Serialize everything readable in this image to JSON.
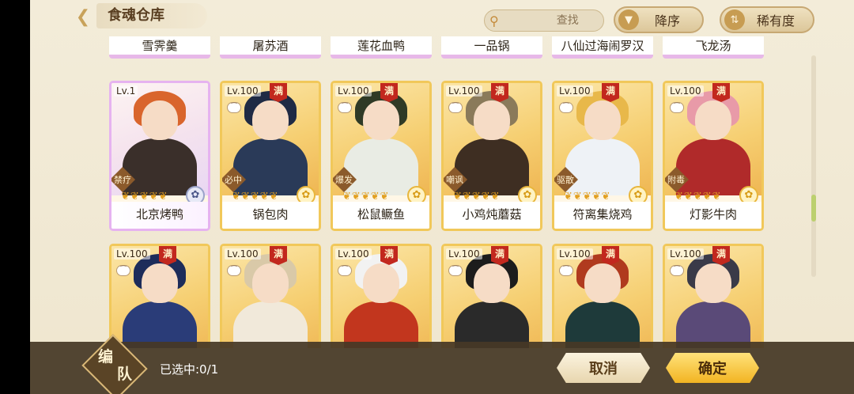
{
  "header": {
    "back_icon": "back-arrow-icon",
    "title": "食魂仓库",
    "search": {
      "placeholder": "查找",
      "value": ""
    },
    "sort_label": "降序",
    "rarity_label": "稀有度"
  },
  "top_row_names": [
    "雪霁羹",
    "屠苏酒",
    "莲花血鸭",
    "一品锅",
    "八仙过海闹罗汉",
    "飞龙汤"
  ],
  "cards_row1": [
    {
      "level": "Lv.1",
      "name": "北京烤鸭",
      "role": "禁疗",
      "maxed": "",
      "frame": "rainbow",
      "hair": "#d9652c",
      "body": "#3a2f2a"
    },
    {
      "level": "Lv.100",
      "name": "锅包肉",
      "role": "必中",
      "maxed": "满",
      "frame": "gold",
      "hair": "#1f2a44",
      "body": "#2a3a58"
    },
    {
      "level": "Lv.100",
      "name": "松鼠鳜鱼",
      "role": "爆发",
      "maxed": "满",
      "frame": "gold",
      "hair": "#2f3a26",
      "body": "#e9ece4"
    },
    {
      "level": "Lv.100",
      "name": "小鸡炖蘑菇",
      "role": "嘲讽",
      "maxed": "满",
      "frame": "gold",
      "hair": "#8a7a5a",
      "body": "#3e2e22"
    },
    {
      "level": "Lv.100",
      "name": "符离集烧鸡",
      "role": "驱散",
      "maxed": "满",
      "frame": "gold",
      "hair": "#e8b84a",
      "body": "#eef2f6"
    },
    {
      "level": "Lv.100",
      "name": "灯影牛肉",
      "role": "附毒",
      "maxed": "满",
      "frame": "gold",
      "hair": "#e89aa8",
      "body": "#b02a2a"
    }
  ],
  "cards_row2": [
    {
      "level": "Lv.100",
      "maxed": "满",
      "hair": "#1d2c5a",
      "body": "#2a3c78"
    },
    {
      "level": "Lv.100",
      "maxed": "满",
      "hair": "#d9c9a8",
      "body": "#f1e9da"
    },
    {
      "level": "Lv.100",
      "maxed": "满",
      "hair": "#f2f2f2",
      "body": "#c2361e"
    },
    {
      "level": "Lv.100",
      "maxed": "满",
      "hair": "#1c1c1c",
      "body": "#2a2a2a"
    },
    {
      "level": "Lv.100",
      "maxed": "满",
      "hair": "#b03a1e",
      "body": "#1e3a3a"
    },
    {
      "level": "Lv.100",
      "maxed": "满",
      "hair": "#3a3a48",
      "body": "#5a4a78"
    }
  ],
  "bottom": {
    "team_char1": "编",
    "team_char2": "队",
    "selected_count": "已选中:0/1",
    "cancel_label": "取消",
    "confirm_label": "确定"
  },
  "colors": {
    "gold_frame": "#f1c85a",
    "rainbow_frame": "#e6b3f0",
    "confirm": "#f2b422",
    "bottom_bar": "#463826"
  }
}
